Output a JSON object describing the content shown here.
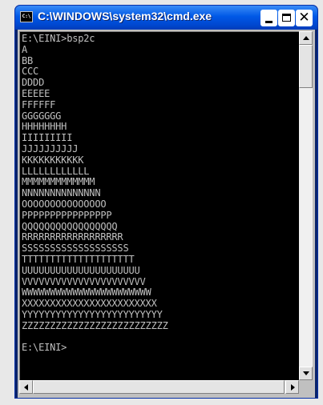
{
  "window": {
    "title": "C:\\WINDOWS\\system32\\cmd.exe",
    "icon_label": "C:\\",
    "close_glyph": "✕"
  },
  "console": {
    "lines": [
      "E:\\EINI>bsp2c",
      "A",
      "BB",
      "CCC",
      "DDDD",
      "EEEEE",
      "FFFFFF",
      "GGGGGGG",
      "HHHHHHHH",
      "IIIIIIIII",
      "JJJJJJJJJJ",
      "KKKKKKKKKKK",
      "LLLLLLLLLLLL",
      "MMMMMMMMMMMMM",
      "NNNNNNNNNNNNNN",
      "OOOOOOOOOOOOOOO",
      "PPPPPPPPPPPPPPPP",
      "QQQQQQQQQQQQQQQQQ",
      "RRRRRRRRRRRRRRRRRR",
      "SSSSSSSSSSSSSSSSSSS",
      "TTTTTTTTTTTTTTTTTTTT",
      "UUUUUUUUUUUUUUUUUUUUU",
      "VVVVVVVVVVVVVVVVVVVVVV",
      "WWWWWWWWWWWWWWWWWWWWWWW",
      "XXXXXXXXXXXXXXXXXXXXXXXX",
      "YYYYYYYYYYYYYYYYYYYYYYYYY",
      "ZZZZZZZZZZZZZZZZZZZZZZZZZZ",
      "",
      "E:\\EINI>"
    ],
    "text_color": "#c0c0c0",
    "background": "#000000"
  },
  "colors": {
    "titlebar": "#0058e6",
    "frame": "#c0c0c0"
  }
}
